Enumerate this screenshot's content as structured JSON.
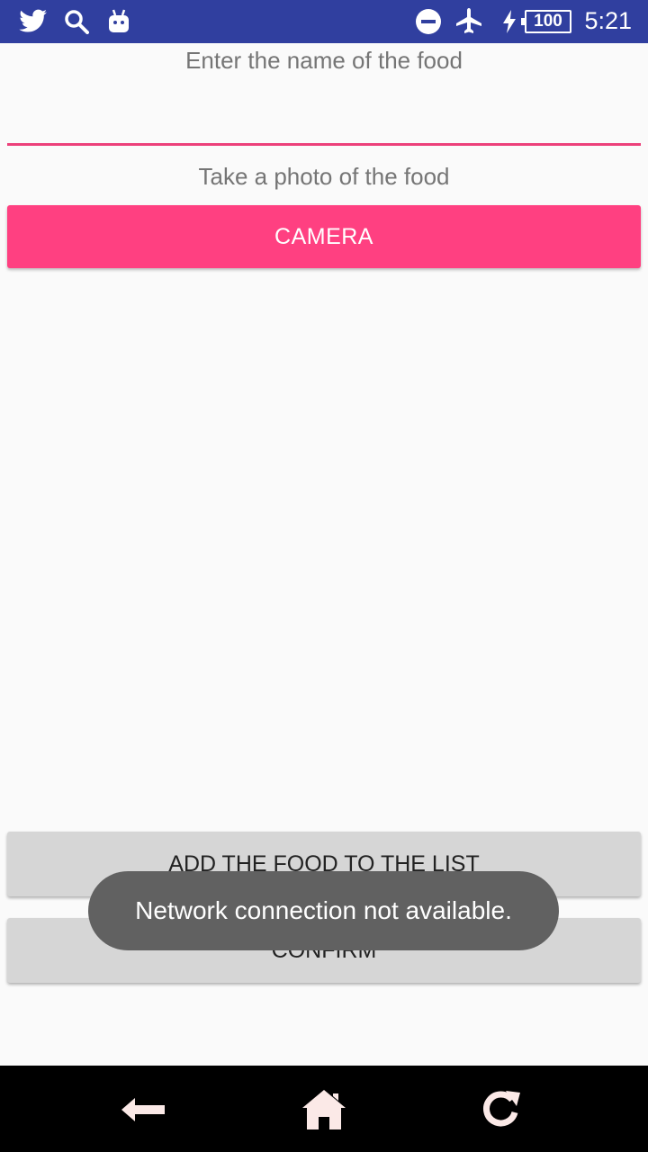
{
  "status_bar": {
    "time": "5:21",
    "battery": "100",
    "icons": [
      "twitter-icon",
      "search-icon",
      "android-icon",
      "do-not-disturb-icon",
      "airplane-mode-icon",
      "charging-icon",
      "battery-icon"
    ]
  },
  "form": {
    "food_name_label": "Enter the name of the food",
    "food_name_value": "",
    "photo_label": "Take a photo of the food",
    "camera_button": "CAMERA",
    "add_button": "ADD THE FOOD TO THE LIST",
    "confirm_button": "CONFIRM"
  },
  "toast": {
    "message": "Network connection not available."
  },
  "nav_bar": {
    "icons": [
      "back-arrow-icon",
      "home-icon",
      "refresh-icon"
    ]
  },
  "colors": {
    "status_bar": "#303f9f",
    "accent": "#ff4081",
    "input_underline": "#ec407a",
    "gray_button": "#d6d6d6",
    "toast": "#616161"
  }
}
